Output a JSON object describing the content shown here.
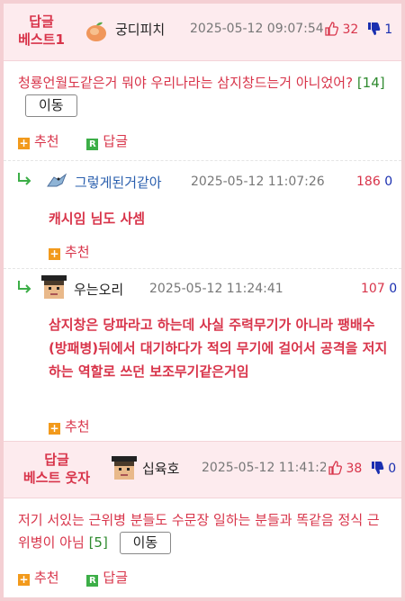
{
  "best1": {
    "label_line1": "답글",
    "label_line2": "베스트1",
    "nick": "궁디피치",
    "date": "2025-05-12 09:07:54",
    "upvotes": "32",
    "downvotes": "1",
    "text": "청룡언월도같은거 뭐야 우리나라는 삼지창드는거 아니었어?",
    "reply_count": "[14]",
    "move_button": "이동",
    "recommend": "추천",
    "reply": "답글"
  },
  "replies": [
    {
      "nick": "그렇게된거같아",
      "date": "2025-05-12 11:07:26",
      "upvotes": "186",
      "downvotes": "0",
      "text": "캐시임 님도 사셈",
      "recommend": "추천"
    },
    {
      "nick": "우는오리",
      "date": "2025-05-12 11:24:41",
      "upvotes": "107",
      "downvotes": "0",
      "text": "삼지창은 당파라고 하는데 사실 주력무기가 아니라 팽배수(방패병)뒤에서 대기하다가 적의 무기에 걸어서 공격을 저지하는 역할로 쓰던 보조무기같은거임",
      "recommend": "추천"
    }
  ],
  "best2": {
    "label_line1": "답글",
    "label_line2": "베스트 웃자",
    "nick": "십육호",
    "date": "2025-05-12 11:41:28",
    "upvotes": "38",
    "downvotes": "0",
    "text": "저기 서있는 근위병 분들도 수문장 일하는 분들과 똑같음 정식 근위병이 아님",
    "reply_count": "[5]",
    "move_button": "이동",
    "recommend": "추천",
    "reply": "답글"
  },
  "colors": {
    "accent": "#d8344a",
    "down": "#1a2fb0",
    "header_bg": "#fdebee",
    "frame": "#f4cfd3",
    "plus_icon": "#f29a1c",
    "reply_icon": "#3cae47"
  }
}
